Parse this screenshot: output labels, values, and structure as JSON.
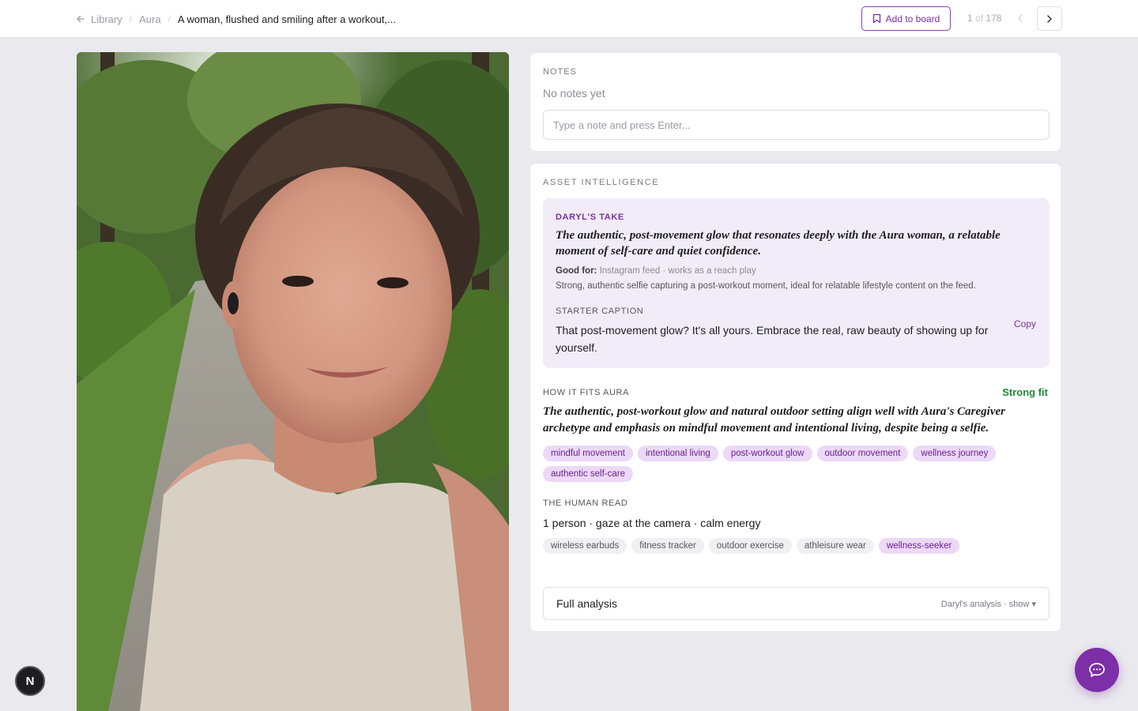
{
  "breadcrumb": {
    "library": "Library",
    "collection": "Aura",
    "current": "A woman, flushed and smiling after a workout,..."
  },
  "header": {
    "add_to_board": "Add to board",
    "pager_current": "1",
    "pager_of": "of",
    "pager_total": "178"
  },
  "photo": {
    "alt": "A woman, flushed and smiling after a workout, selfie on a wooded trail"
  },
  "notes": {
    "title": "NOTES",
    "empty": "No notes yet",
    "placeholder": "Type a note and press Enter..."
  },
  "intelligence": {
    "title": "ASSET INTELLIGENCE",
    "take": {
      "label": "DARYL'S TAKE",
      "quote": "The authentic, post-movement glow that resonates deeply with the Aura woman, a relatable moment of self-care and quiet confidence.",
      "good_for_label": "Good for:",
      "good_for_value": "Instagram feed · works as a reach play",
      "description": "Strong, authentic selfie capturing a post-workout moment, ideal for relatable lifestyle content on the feed.",
      "starter_label": "STARTER CAPTION",
      "starter_text": "That post-movement glow? It's all yours. Embrace the real, raw beauty of showing up for yourself.",
      "copy": "Copy"
    },
    "fits": {
      "label": "HOW IT FITS AURA",
      "badge": "Strong fit",
      "quote": "The authentic, post-workout glow and natural outdoor setting align well with Aura's Caregiver archetype and emphasis on mindful movement and intentional living, despite being a selfie.",
      "tags": [
        "mindful movement",
        "intentional living",
        "post-workout glow",
        "outdoor movement",
        "wellness journey",
        "authentic self-care"
      ]
    },
    "human": {
      "label": "THE HUMAN READ",
      "summary": "1 person · gaze at the camera · calm energy",
      "tags": [
        "wireless earbuds",
        "fitness tracker",
        "outdoor exercise",
        "athleisure wear"
      ],
      "persona_tags": [
        "wellness-seeker"
      ]
    },
    "full_analysis": {
      "title": "Full analysis",
      "meta": "Daryl's analysis · show ▾"
    }
  },
  "badges": {
    "n_badge": "N"
  },
  "colors": {
    "accent": "#7c2fa6",
    "take_bg": "#f2ecf8",
    "strong_fit": "#1e8a3a"
  }
}
